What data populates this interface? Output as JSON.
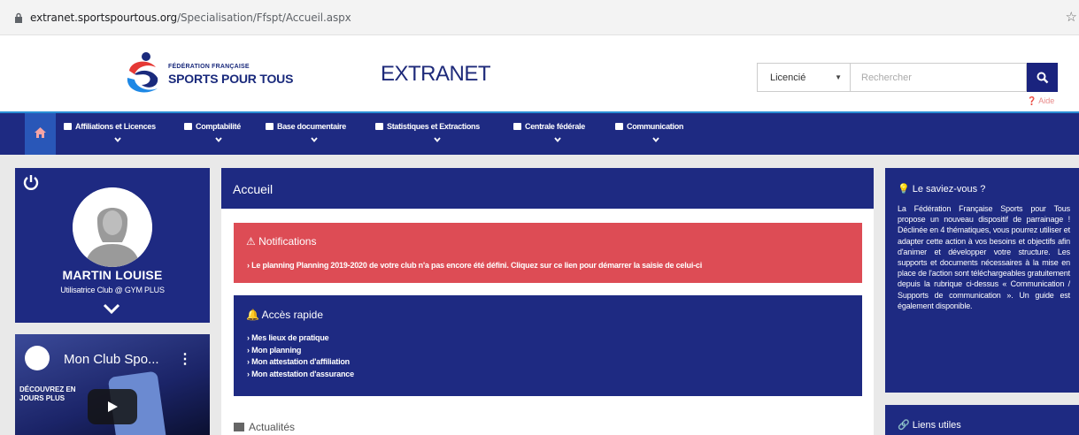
{
  "browser": {
    "url_host": "extranet.sportspourtous.org",
    "url_path": "/Specialisation/Ffspt/Accueil.aspx"
  },
  "header": {
    "logo_line1": "FÉDÉRATION FRANÇAISE",
    "logo_line2": "SPORTS POUR TOUS",
    "site_title": "EXTRANET",
    "search_scope": "Licencié",
    "search_placeholder": "Rechercher",
    "help_label": "Aide"
  },
  "nav": {
    "items": [
      {
        "label": "Affiliations et Licences",
        "icon": "user-icon"
      },
      {
        "label": "Comptabilité",
        "icon": "calculator-icon"
      },
      {
        "label": "Base documentaire",
        "icon": "folder-icon"
      },
      {
        "label": "Statistiques et Extractions",
        "icon": "bar-chart-icon"
      },
      {
        "label": "Centrale fédérale",
        "icon": "calendar-icon"
      },
      {
        "label": "Communication",
        "icon": "envelope-icon"
      }
    ]
  },
  "profile": {
    "name": "MARTIN LOUISE",
    "role": "Utilisatrice Club @ GYM PLUS"
  },
  "video": {
    "title": "Mon Club Spo...",
    "overlay_text": "DÉCOUVREZ EN\nJOURS PLUS"
  },
  "main": {
    "title": "Accueil",
    "notifications": {
      "title": "Notifications",
      "message": "Le planning Planning 2019-2020 de votre club n'a pas encore été défini. Cliquez sur ce lien pour démarrer la saisie de celui-ci"
    },
    "quick_access": {
      "title": "Accès rapide",
      "links": [
        "Mes lieux de pratique",
        "Mon planning",
        "Mon attestation d'affiliation",
        "Mon attestation d'assurance"
      ]
    },
    "news_title": "Actualités"
  },
  "sidebar_right": {
    "tip_title": "Le saviez-vous ?",
    "tip_body": "La Fédération Française Sports pour Tous propose un nouveau dispositif de parrainage ! Déclinée en 4 thématiques, vous pourrez utiliser et adapter cette action à vos besoins et objectifs afin d'animer et développer votre structure. Les supports et documents nécessaires à la mise en place de l'action sont téléchargeables gratuitement depuis la rubrique ci-dessus « Communication / Supports de communication ». Un guide est également disponible.",
    "links_title": "Liens utiles"
  },
  "colors": {
    "navy": "#1e2a82",
    "nav_accent": "#2a8fd6",
    "home_tab": "#2957b8",
    "alert_red": "#dd4c55",
    "page_bg": "#e9e9e9"
  }
}
